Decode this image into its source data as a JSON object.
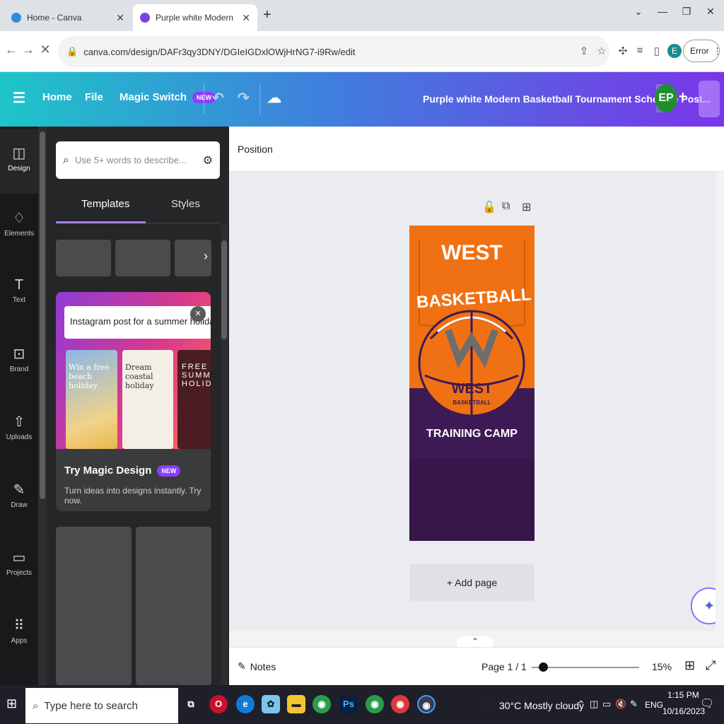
{
  "browser": {
    "tabs": [
      {
        "title": "Home - Canva",
        "active": false
      },
      {
        "title": "Purple white Modern Basketball",
        "active": true
      }
    ],
    "new_tab": "+",
    "url": "canva.com/design/DAFr3qy3DNY/DGIeIGDxlOWjHrNG7-i9Rw/edit",
    "profile_initial": "E",
    "error_label": "Error"
  },
  "canva": {
    "nav": {
      "home": "Home",
      "file": "File",
      "magic_switch": "Magic Switch",
      "new_badge": "NEW"
    },
    "doc_title": "Purple white Modern Basketball Tournament Schedule Post...",
    "avatar": "EP",
    "plus": "+",
    "position_label": "Position"
  },
  "sidebar": {
    "items": [
      {
        "label": "Design",
        "icon": "design-icon"
      },
      {
        "label": "Elements",
        "icon": "elements-icon"
      },
      {
        "label": "Text",
        "icon": "text-icon"
      },
      {
        "label": "Brand",
        "icon": "brand-icon"
      },
      {
        "label": "Uploads",
        "icon": "uploads-icon"
      },
      {
        "label": "Draw",
        "icon": "draw-icon"
      },
      {
        "label": "Projects",
        "icon": "projects-icon"
      },
      {
        "label": "Apps",
        "icon": "apps-icon"
      }
    ]
  },
  "panel": {
    "search_placeholder": "Use 5+ words to describe...",
    "tabs": {
      "templates": "Templates",
      "styles": "Styles"
    },
    "magic": {
      "prompt": "Instagram post for a summer holiday promo",
      "title": "Try Magic Design",
      "badge": "NEW",
      "desc": "Turn ideas into designs instantly. Try now.",
      "cards": [
        "Win a free beach holiday",
        "Dream coastal holiday",
        "FREE SUMMER HOLIDAY"
      ]
    }
  },
  "design": {
    "line1": "WEST",
    "line2": "BASKETBALL",
    "logo_text": "WEST",
    "logo_sub": "BASKETBALL",
    "line3": "TRAINING CAMP",
    "colors": {
      "orange": "#f07113",
      "purple": "#3e1a54"
    }
  },
  "canvas": {
    "add_page": "+ Add page",
    "notes": "Notes",
    "page_label": "Page 1 / 1",
    "zoom": "15%"
  },
  "taskbar": {
    "search_placeholder": "Type here to search",
    "weather": "30°C  Mostly cloudy",
    "lang": "ENG",
    "time": "1:15 PM",
    "date": "10/16/2023"
  }
}
